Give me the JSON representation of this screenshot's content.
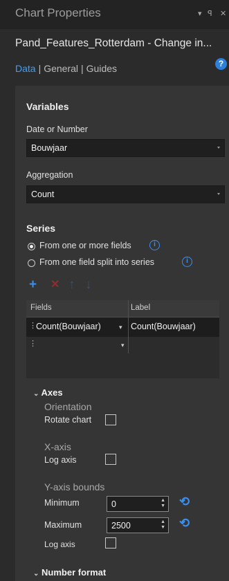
{
  "window": {
    "title": "Chart Properties",
    "controls": {
      "menu": "▾",
      "pin": "ꟼ",
      "close": "✕"
    }
  },
  "chart_title": "Pand_Features_Rotterdam - Change in...",
  "tabs": [
    {
      "label": "Data",
      "active": true
    },
    {
      "label": "General",
      "active": false
    },
    {
      "label": "Guides",
      "active": false
    }
  ],
  "help_icon_glyph": "?",
  "variables": {
    "heading": "Variables",
    "date_or_number_label": "Date or Number",
    "date_or_number_value": "Bouwjaar",
    "aggregation_label": "Aggregation",
    "aggregation_value": "Count"
  },
  "series": {
    "heading": "Series",
    "option1": "From one or more fields",
    "option2": "From one field split into series",
    "selected": "option1",
    "info_glyph": "i",
    "tools": {
      "add": "+",
      "remove": "✕",
      "up": "↑",
      "down": "↓"
    },
    "grid": {
      "headers": [
        "Fields",
        "Label"
      ],
      "rows": [
        {
          "field": "Count(Bouwjaar)",
          "label": "Count(Bouwjaar)"
        },
        {
          "field": "",
          "label": ""
        }
      ]
    }
  },
  "axes": {
    "heading": "Axes",
    "orientation_label": "Orientation",
    "rotate_chart_label": "Rotate chart",
    "x_axis_label": "X-axis",
    "x_log_axis_label": "Log axis",
    "y_axis_bounds_label": "Y-axis bounds",
    "minimum_label": "Minimum",
    "minimum_value": "0",
    "maximum_label": "Maximum",
    "maximum_value": "2500",
    "y_log_axis_label": "Log axis",
    "reset_glyph": "⟲"
  },
  "number_format": {
    "heading": "Number format"
  },
  "colors": {
    "accent": "#3aa0ff",
    "background": "#2b2b2b",
    "panel": "#353535"
  }
}
